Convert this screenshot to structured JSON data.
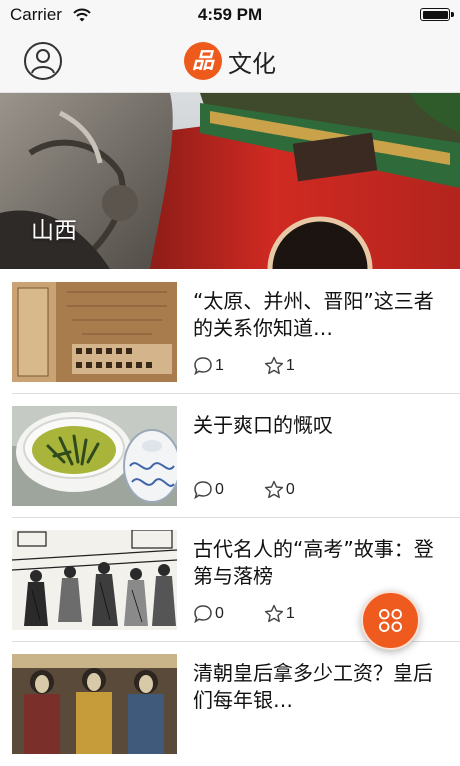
{
  "status_bar": {
    "carrier": "Carrier",
    "time": "4:59 PM"
  },
  "nav": {
    "title": "文化",
    "logo_glyph": "品"
  },
  "banner": {
    "label": "山西"
  },
  "colors": {
    "accent": "#ef5a1e",
    "separator": "#dedede"
  },
  "icons": {
    "profile": "person-circle-icon",
    "comment": "comment-bubble-icon",
    "like": "star-outline-icon",
    "fab": "grid-menu-icon"
  },
  "articles": [
    {
      "title": "“太原、并州、晋阳”这三者的关系你知道…",
      "comments": "1",
      "likes": "1"
    },
    {
      "title": "关于爽口的慨叹",
      "comments": "0",
      "likes": "0"
    },
    {
      "title": "古代名人的“高考”故事：登第与落榜",
      "comments": "0",
      "likes": "1"
    },
    {
      "title": "清朝皇后拿多少工资？皇后们每年银…"
    }
  ]
}
